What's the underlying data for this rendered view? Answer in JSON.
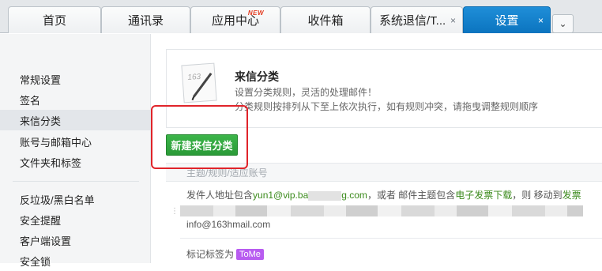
{
  "tabs": [
    {
      "label": "首页"
    },
    {
      "label": "通讯录"
    },
    {
      "label": "应用中心",
      "badge": "NEW"
    },
    {
      "label": "收件箱"
    },
    {
      "label": "系统退信/T...",
      "close": "×"
    },
    {
      "label": "设置",
      "close": "×",
      "active": true
    }
  ],
  "more_button": "⌄",
  "sidebar": {
    "items": [
      {
        "label": "常规设置"
      },
      {
        "label": "签名"
      },
      {
        "label": "来信分类",
        "active": true
      },
      {
        "label": "账号与邮箱中心"
      },
      {
        "label": "文件夹和标签"
      },
      {
        "label": "反垃圾/黑白名单"
      },
      {
        "label": "安全提醒"
      },
      {
        "label": "客户端设置"
      },
      {
        "label": "安全锁"
      }
    ]
  },
  "main": {
    "logo_text": "163",
    "title": "来信分类",
    "desc1": "设置分类规则，灵活的处理邮件！",
    "desc2": "分类规则按排列从下至上依次执行，如有规则冲突，请拖曳调整规则顺序",
    "new_button": "新建来信分类",
    "list_header": "主题/规则/适应账号",
    "rule": {
      "p1": "发件人地址包含",
      "addr": "yun1@vip.ba",
      "p2": "g.com",
      "p3": "，或者 邮件主题包含",
      "kw": "电子发票下载",
      "p4": "，则 移动到",
      "folder": "发票"
    },
    "email_line": "info@163hmail.com",
    "tag_prefix": "标记标签为",
    "tag_label": "ToMe"
  },
  "colors": {
    "active_tab": "#1485d1",
    "button_green": "#34a843",
    "highlight_red": "#e0242a",
    "tag_purple": "#b85cf0"
  }
}
